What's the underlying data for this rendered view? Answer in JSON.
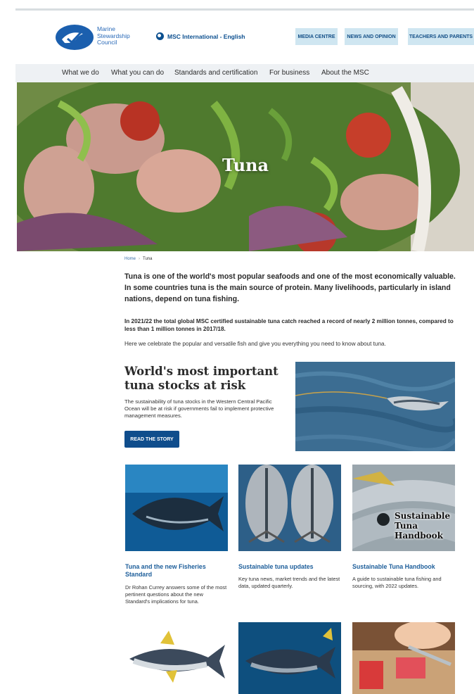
{
  "header": {
    "logo_text_line1": "Marine",
    "logo_text_line2": "Stewardship",
    "logo_text_line3": "Council",
    "language": "MSC International - English",
    "util_buttons": [
      "MEDIA CENTRE",
      "NEWS AND OPINION",
      "TEACHERS AND PARENTS"
    ]
  },
  "nav": {
    "items": [
      "What we do",
      "What you can do",
      "Standards and certification",
      "For business",
      "About the MSC"
    ]
  },
  "hero": {
    "title": "Tuna"
  },
  "breadcrumb": {
    "home": "Home",
    "separator": "›",
    "current": "Tuna"
  },
  "content": {
    "intro": "Tuna is one of the world's most popular seafoods and one of the most economically valuable. In some countries tuna is the main source of protein. Many livelihoods, particularly in island nations, depend on tuna fishing.",
    "para1": "In 2021/22 the total global MSC certified sustainable tuna catch reached a record of nearly 2 million tonnes, compared to less than 1 million tonnes in 2017/18.",
    "para2": "Here we celebrate the popular and versatile fish and give you everything you need to know about tuna."
  },
  "feature": {
    "title": "World's most important tuna stocks at risk",
    "text": "The sustainability of tuna stocks in the Western Central Pacific Ocean will be at risk if governments fail to implement protective management measures.",
    "button": "READ THE STORY"
  },
  "cards": [
    {
      "title": "Tuna and the new Fisheries Standard",
      "text": "Dr Rohan Currey answers some of the most pertinent questions about the new Standard's implications for tuna."
    },
    {
      "title": "Sustainable tuna updates",
      "text": "Key tuna news, market trends and the latest data, updated quarterly."
    },
    {
      "title": "Sustainable Tuna Handbook",
      "text": "A guide to sustainable tuna fishing and sourcing, with 2022 updates.",
      "image_label": [
        "Sustainable",
        "Tuna",
        "Handbook"
      ]
    }
  ],
  "colors": {
    "brand_blue": "#0f4d8c",
    "link_blue": "#1d5e9a",
    "util_bg": "#cfe6f1",
    "nav_bg": "#eef1f4"
  }
}
